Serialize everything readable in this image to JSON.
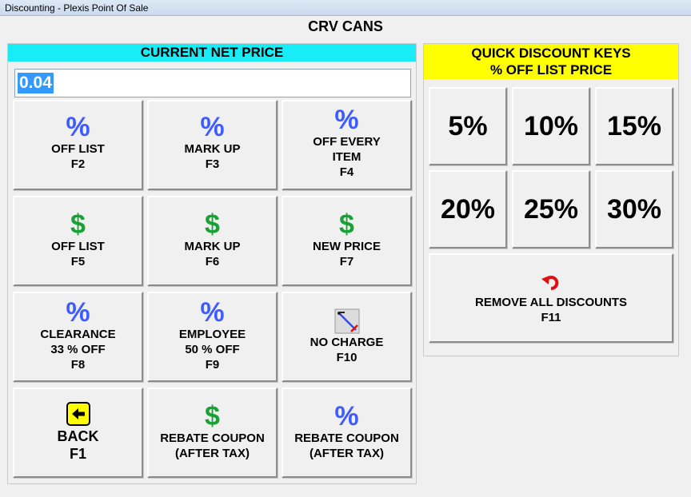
{
  "window": {
    "title": "Discounting - Plexis Point Of Sale"
  },
  "item": {
    "name": "CRV CANS"
  },
  "left": {
    "header": "CURRENT NET PRICE",
    "price_value": "0.04",
    "buttons": [
      {
        "icon": "percent-icon",
        "glyph": "%",
        "line1": "OFF LIST",
        "line2": "F2"
      },
      {
        "icon": "percent-icon",
        "glyph": "%",
        "line1": "MARK UP",
        "line2": "F3"
      },
      {
        "icon": "percent-icon",
        "glyph": "%",
        "line1": "OFF EVERY",
        "line1b": "ITEM",
        "line2": "F4"
      },
      {
        "icon": "dollar-icon",
        "glyph": "$",
        "line1": "OFF LIST",
        "line2": "F5"
      },
      {
        "icon": "dollar-icon",
        "glyph": "$",
        "line1": "MARK UP",
        "line2": "F6"
      },
      {
        "icon": "dollar-icon",
        "glyph": "$",
        "line1": "NEW PRICE",
        "line2": "F7"
      },
      {
        "icon": "percent-icon",
        "glyph": "%",
        "line1": "CLEARANCE",
        "line1b": "33 % OFF",
        "line2": "F8"
      },
      {
        "icon": "percent-icon",
        "glyph": "%",
        "line1": "EMPLOYEE",
        "line1b": "50 % OFF",
        "line2": "F9"
      },
      {
        "icon": "no-charge-icon",
        "line1": "NO CHARGE",
        "line2": "F10"
      },
      {
        "icon": "back-arrow-icon",
        "line1": "BACK",
        "line2": "F1"
      },
      {
        "icon": "dollar-icon",
        "glyph": "$",
        "line1": "REBATE COUPON",
        "line2": "(AFTER TAX)"
      },
      {
        "icon": "percent-icon",
        "glyph": "%",
        "line1": "REBATE COUPON",
        "line2": "(AFTER TAX)"
      }
    ]
  },
  "right": {
    "header_line1": "QUICK DISCOUNT KEYS",
    "header_line2": "% OFF LIST PRICE",
    "quick_keys": [
      "5%",
      "10%",
      "15%",
      "20%",
      "25%",
      "30%"
    ],
    "remove": {
      "icon": "undo-arrow-icon",
      "line1": "REMOVE ALL DISCOUNTS",
      "line2": "F11"
    }
  },
  "colors": {
    "cyan_header": "#17ecf7",
    "yellow_header": "#ffff00",
    "percent_blue": "#3d5bff",
    "dollar_green": "#18a235",
    "selection_blue": "#3399ff",
    "undo_red": "#e01010"
  }
}
